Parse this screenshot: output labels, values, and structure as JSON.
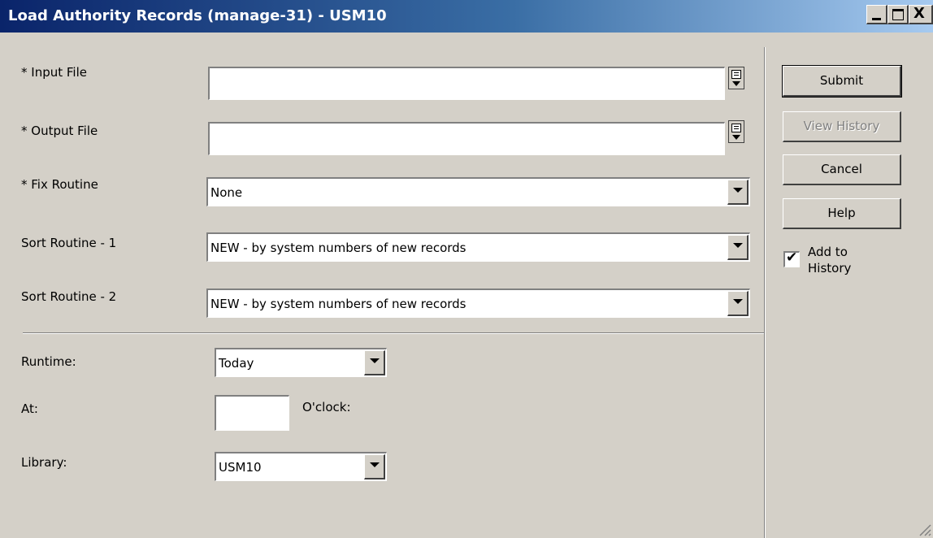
{
  "window": {
    "title": "Load Authority Records (manage-31) - USM10",
    "close_glyph": "X"
  },
  "form": {
    "input_file": {
      "label": "* Input File",
      "value": ""
    },
    "output_file": {
      "label": "* Output File",
      "value": ""
    },
    "fix_routine": {
      "label": "* Fix Routine",
      "value": "None"
    },
    "sort_routine_1": {
      "label": "Sort Routine - 1",
      "value": "NEW - by system numbers of new records"
    },
    "sort_routine_2": {
      "label": "Sort Routine - 2",
      "value": "NEW - by system numbers of new records"
    },
    "runtime": {
      "label": "Runtime:",
      "value": "Today"
    },
    "at": {
      "label": "At:",
      "value": "",
      "suffix": "O'clock:"
    },
    "library": {
      "label": "Library:",
      "value": "USM10"
    }
  },
  "actions": {
    "submit": "Submit",
    "view_history": "View History",
    "cancel": "Cancel",
    "help": "Help",
    "add_to_history": {
      "label": "Add to History",
      "checked": true
    }
  }
}
